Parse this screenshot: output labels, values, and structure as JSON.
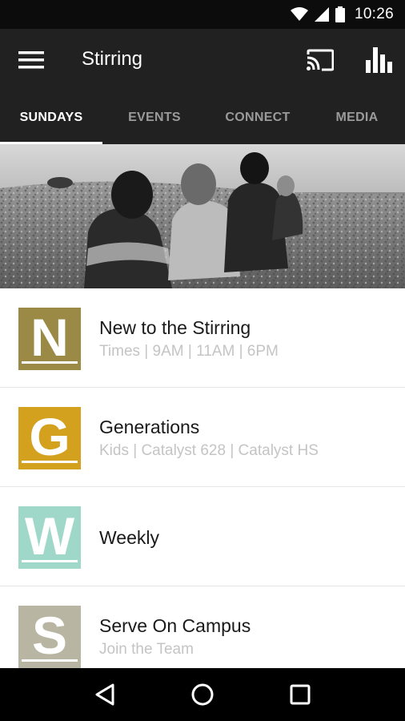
{
  "status_bar": {
    "time": "10:26"
  },
  "app_bar": {
    "title": "Stirring"
  },
  "tabs": [
    {
      "label": "SUNDAYS",
      "active": true
    },
    {
      "label": "EVENTS",
      "active": false
    },
    {
      "label": "CONNECT",
      "active": false
    },
    {
      "label": "MEDIA",
      "active": false
    }
  ],
  "list": [
    {
      "letter": "N",
      "title": "New to the Stirring",
      "subtitle": "Times | 9AM | 11AM | 6PM",
      "color": "#9a8a45"
    },
    {
      "letter": "G",
      "title": "Generations",
      "subtitle": "Kids | Catalyst 628 | Catalyst HS",
      "color": "#d4a11e"
    },
    {
      "letter": "W",
      "title": "Weekly",
      "subtitle": "",
      "color": "#9fd8c8"
    },
    {
      "letter": "S",
      "title": "Serve On Campus",
      "subtitle": "Join the Team",
      "color": "#b9b5a3"
    }
  ],
  "icons": {
    "menu": "hamburger-menu-icon",
    "cast": "cast-icon",
    "chart": "bar-chart-icon",
    "wifi": "wifi-icon",
    "signal": "signal-icon",
    "battery": "battery-icon",
    "back": "back-icon",
    "home": "home-icon",
    "recents": "recents-icon"
  }
}
